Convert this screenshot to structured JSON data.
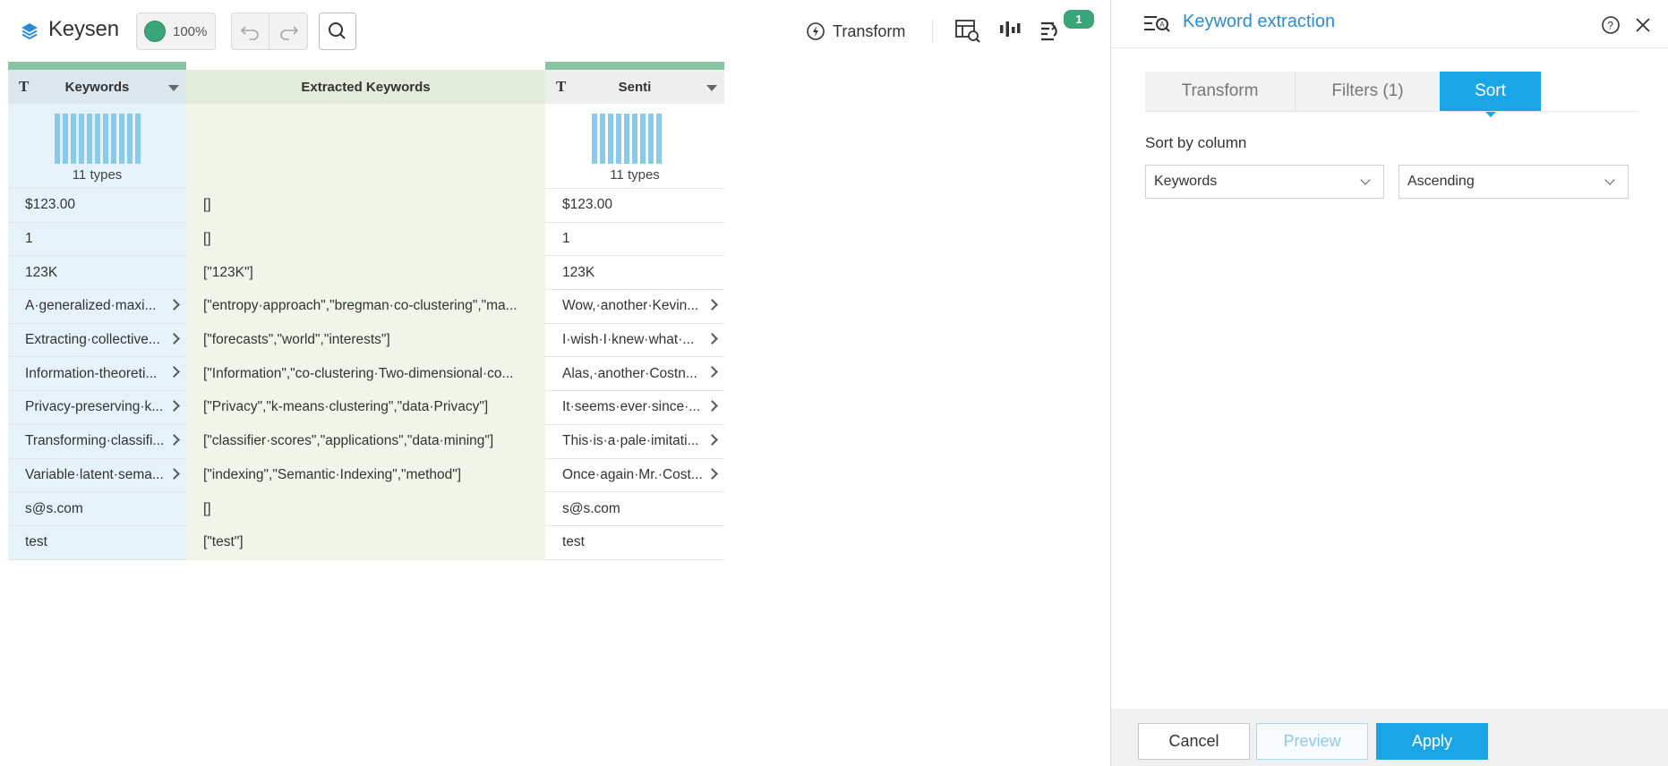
{
  "app": {
    "title": "Keysen",
    "zoom": "100%"
  },
  "toolbar": {
    "transform_label": "Transform",
    "steps_badge": "1"
  },
  "grid": {
    "columns": [
      {
        "name": "Keywords",
        "type_glyph": "T",
        "types": "11 types"
      },
      {
        "name": "Extracted Keywords"
      },
      {
        "name": "Senti",
        "type_glyph": "T",
        "types": "11 types"
      }
    ],
    "rows": [
      {
        "keywords": "$123.00",
        "extracted": "[]",
        "senti": "$123.00"
      },
      {
        "keywords": "1",
        "extracted": "[]",
        "senti": "1"
      },
      {
        "keywords": "123K",
        "extracted": "[\"123K\"]",
        "senti": "123K"
      },
      {
        "keywords": "A·generalized·maxi...",
        "extracted": "[\"entropy·approach\",\"bregman·co-clustering\",\"ma...",
        "senti": "Wow,·another·Kevin..."
      },
      {
        "keywords": "Extracting·collective...",
        "extracted": "[\"forecasts\",\"world\",\"interests\"]",
        "senti": "I·wish·I·knew·what·..."
      },
      {
        "keywords": "Information-theoreti...",
        "extracted": "[\"Information\",\"co-clustering·Two-dimensional·co...",
        "senti": "Alas,·another·Costn..."
      },
      {
        "keywords": "Privacy-preserving·k...",
        "extracted": "[\"Privacy\",\"k-means·clustering\",\"data·Privacy\"]",
        "senti": "It·seems·ever·since·..."
      },
      {
        "keywords": "Transforming·classifi...",
        "extracted": "[\"classifier·scores\",\"applications\",\"data·mining\"]",
        "senti": "This·is·a·pale·imitati..."
      },
      {
        "keywords": "Variable·latent·sema...",
        "extracted": "[\"indexing\",\"Semantic·Indexing\",\"method\"]",
        "senti": "Once·again·Mr.·Cost..."
      },
      {
        "keywords": "s@s.com",
        "extracted": "[]",
        "senti": "s@s.com"
      },
      {
        "keywords": "test",
        "extracted": "[\"test\"]",
        "senti": "test"
      }
    ]
  },
  "panel": {
    "title": "Keyword extraction",
    "tabs": [
      "Transform",
      "Filters (1)",
      "Sort"
    ],
    "active_tab": "Sort",
    "sort_label": "Sort by column",
    "sort_column": "Keywords",
    "sort_order": "Ascending",
    "footer": {
      "cancel": "Cancel",
      "preview": "Preview",
      "apply": "Apply"
    }
  },
  "colors": {
    "accent": "#1aa6e6",
    "green": "#3aa47a",
    "title_blue": "#2e8ad6"
  }
}
